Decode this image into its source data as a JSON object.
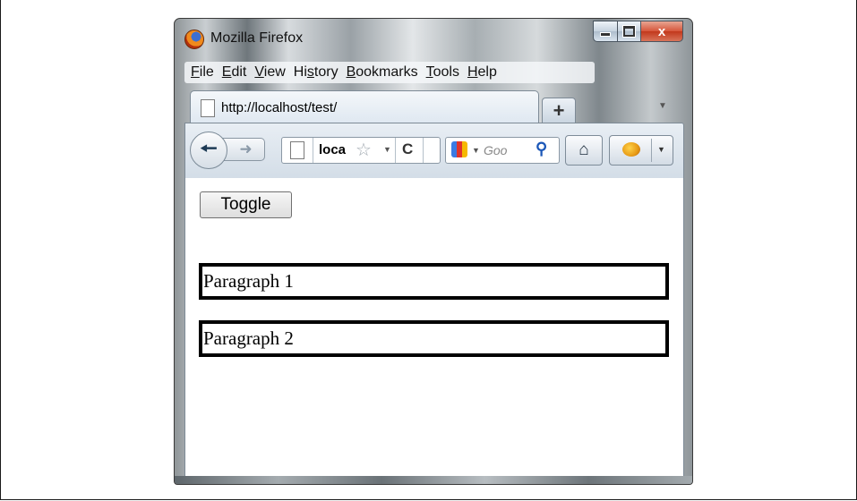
{
  "window": {
    "title": "Mozilla Firefox",
    "caption_buttons": {
      "minimize": "",
      "maximize": "",
      "close": "x"
    }
  },
  "menubar": {
    "items": [
      {
        "label": "File",
        "accel": "F",
        "rest": "ile"
      },
      {
        "label": "Edit",
        "accel": "E",
        "rest": "dit"
      },
      {
        "label": "View",
        "accel": "V",
        "rest": "iew"
      },
      {
        "label": "History",
        "pre": "Hi",
        "accel": "s",
        "rest": "tory"
      },
      {
        "label": "Bookmarks",
        "accel": "B",
        "rest": "ookmarks"
      },
      {
        "label": "Tools",
        "accel": "T",
        "rest": "ools"
      },
      {
        "label": "Help",
        "accel": "H",
        "rest": "elp"
      }
    ]
  },
  "tabs": {
    "active_tab_title": "http://localhost/test/",
    "new_tab_label": "+"
  },
  "navbar": {
    "url_text": "loca",
    "search_placeholder": "Goo",
    "icons": [
      "back-arrow-icon",
      "forward-arrow-icon",
      "page-icon",
      "star-icon",
      "reload-icon",
      "google-icon",
      "magnifier-icon",
      "home-icon",
      "addon-bug-icon"
    ]
  },
  "content": {
    "toggle_label": "Toggle",
    "paragraphs": [
      "Paragraph 1",
      "Paragraph 2"
    ]
  }
}
